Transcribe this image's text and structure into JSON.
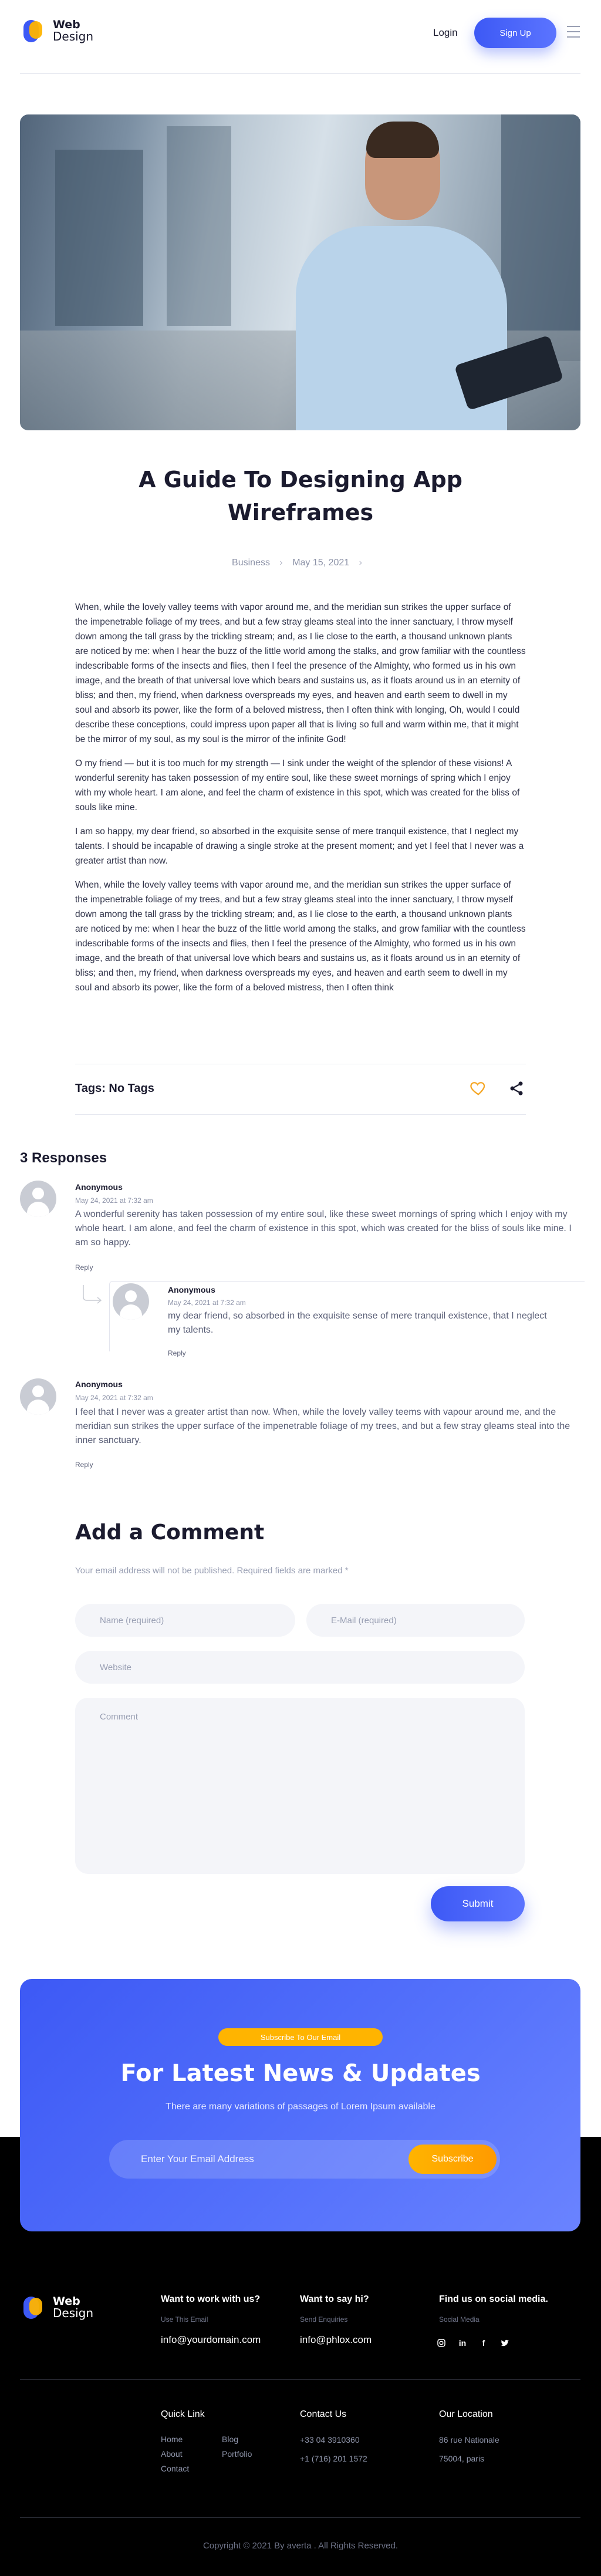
{
  "header": {
    "logo_line1": "Web",
    "logo_line2": "Design",
    "login_label": "Login",
    "signup_label": "Sign Up"
  },
  "article": {
    "title": "A Guide To Designing App Wireframes",
    "category": "Business",
    "date": "May 15, 2021",
    "paragraphs": [
      "When, while the lovely valley teems with vapor around me, and the meridian sun strikes the upper surface of the impenetrable foliage of my trees, and but a few stray gleams steal into the inner sanctuary, I throw myself down among the tall grass by the trickling stream; and, as I lie close to the earth, a thousand unknown plants are noticed by me: when I hear the buzz of the little world among the stalks, and grow familiar with the countless indescribable forms of the insects and flies, then I feel the presence of the Almighty, who formed us in his own image, and the breath of that universal love which bears and sustains us, as it floats around us in an eternity of bliss; and then, my friend, when darkness overspreads my eyes, and heaven and earth seem to dwell in my soul and absorb its power, like the form of a beloved mistress, then I often think with longing, Oh, would I could describe these conceptions, could impress upon paper all that is living so full and warm within me, that it might be the mirror of my soul, as my soul is the mirror of the infinite God!",
      "O my friend — but it is too much for my strength — I sink under the weight of the splendor of these visions! A wonderful serenity has taken possession of my entire soul, like these sweet mornings of spring which I enjoy with my whole heart. I am alone, and feel the charm of existence in this spot, which was created for the bliss of souls like mine.",
      "I am so happy, my dear friend, so absorbed in the exquisite sense of mere tranquil existence, that I neglect my talents. I should be incapable of drawing a single stroke at the present moment; and yet I feel that I never was a greater artist than now.",
      "When, while the lovely valley teems with vapor around me, and the meridian sun strikes the upper surface of the impenetrable foliage of my trees, and but a few stray gleams steal into the inner sanctuary, I throw myself down among the tall grass by the trickling stream; and, as I lie close to the earth, a thousand unknown plants are noticed by me: when I hear the buzz of the little world among the stalks, and grow familiar with the countless indescribable forms of the insects and flies, then I feel the presence of the Almighty, who formed us in his own image, and the breath of that universal love which bears and sustains us, as it floats around us in an eternity of bliss; and then, my friend, when darkness overspreads my eyes, and heaven and earth seem to dwell in my soul and absorb its power, like the form of a beloved mistress, then I often think"
    ],
    "tags_label": "Tags: No Tags"
  },
  "comments": {
    "title": "3 Responses",
    "items": [
      {
        "author": "Anonymous",
        "date": "May 24, 2021 at 7:32 am",
        "text": "A wonderful serenity has taken possession of my entire soul, like these sweet mornings of spring which I enjoy with my whole heart. I am alone, and feel the charm of existence in this spot, which was created for the bliss of souls like mine. I am so happy.",
        "reply": "Reply"
      },
      {
        "author": "Anonymous",
        "date": "May 24, 2021 at 7:32 am",
        "text": "my dear friend, so absorbed in the exquisite sense of mere tranquil existence, that I neglect my talents.",
        "reply": "Reply"
      },
      {
        "author": "Anonymous",
        "date": "May 24, 2021 at 7:32 am",
        "text": "I feel that I never was a greater artist than now. When, while the lovely valley teems with vapour around me, and the meridian sun strikes the upper surface of the impenetrable foliage of my trees, and but a few stray gleams steal into the inner sanctuary.",
        "reply": "Reply"
      }
    ]
  },
  "form": {
    "title": "Add a Comment",
    "note": "Your email address will not be published. Required fields are marked *",
    "name_placeholder": "Name (required)",
    "email_placeholder": "E-Mail (required)",
    "website_placeholder": "Website",
    "comment_placeholder": "Comment",
    "submit_label": "Submit"
  },
  "newsletter": {
    "badge": "Subscribe To Our Email",
    "title": "For Latest News & Updates",
    "subtitle": "There are many variations of passages of Lorem Ipsum available",
    "input_placeholder": "Enter Your Email Address",
    "button_label": "Subscribe"
  },
  "footer": {
    "col1_title": "Want to work with us?",
    "col1_small": "Use This Email",
    "col1_value": "info@yourdomain.com",
    "col2_title": "Want to say hi?",
    "col2_small": "Send Enquiries",
    "col2_value": "info@phlox.com",
    "col3_title": "Find us on social media.",
    "col3_small": "Social Media",
    "social_icons": [
      "instagram-icon",
      "linkedin-icon",
      "facebook-icon",
      "twitter-icon"
    ],
    "quicklink_title": "Quick Link",
    "quicklinks_left": [
      "Home",
      "About",
      "Contact"
    ],
    "quicklinks_right": [
      "Blog",
      "Portfolio"
    ],
    "contact_title": "Contact Us",
    "contact_lines": [
      "+33 04 3910360",
      "+1 (716) 201 1572"
    ],
    "location_title": "Our Location",
    "location_lines": [
      "86 rue Nationale",
      "75004, paris"
    ],
    "copyright": "Copyright © 2021 By averta . All Rights Reserved."
  },
  "colors": {
    "accent": "#3d59f5",
    "accent_yellow": "#ffb400",
    "heart": "#f5a623"
  }
}
